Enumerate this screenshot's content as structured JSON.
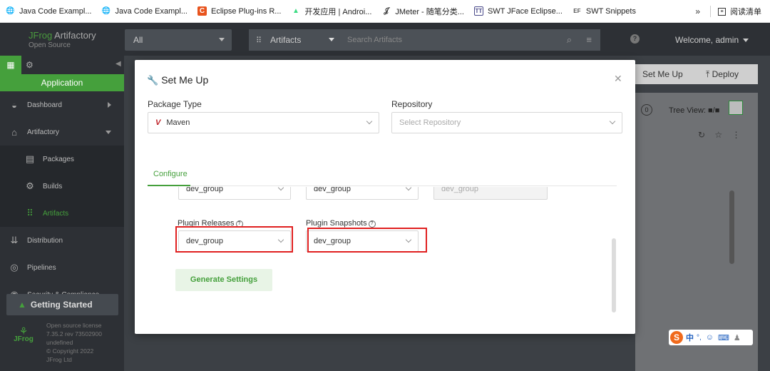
{
  "bookmarks": {
    "items": [
      {
        "label": "Java Code Exampl...",
        "icon": "globe-icon",
        "color": "#333333"
      },
      {
        "label": "Java Code Exampl...",
        "icon": "globe-icon",
        "color": "#333333"
      },
      {
        "label": "Eclipse Plug-ins R...",
        "icon": "c-logo-icon",
        "color": "#e8541e"
      },
      {
        "label": "开发应用 | Androi...",
        "icon": "android-icon",
        "color": "#3ddc84"
      },
      {
        "label": "JMeter - 随笔分类...",
        "icon": "jmeter-icon",
        "color": "#333333"
      },
      {
        "label": "SWT JFace Eclipse...",
        "icon": "tt-icon",
        "color": "#4a4a8a"
      },
      {
        "label": "SWT Snippets",
        "icon": "ef-icon",
        "color": "#555555"
      }
    ],
    "more": "»",
    "reading_list": "阅读清单"
  },
  "topnav": {
    "brand_jfrog": "JFrog",
    "brand_product": " Artifactory",
    "brand_edition": "Open Source",
    "scope_select": "All",
    "package_select": "Artifacts",
    "search_placeholder": "Search Artifacts",
    "welcome": "Welcome, admin"
  },
  "sidebar": {
    "app_label": "Application",
    "items": [
      {
        "label": "Dashboard",
        "icon": "gauge-icon"
      },
      {
        "label": "Artifactory",
        "icon": "artifactory-icon"
      },
      {
        "label": "Packages",
        "icon": "packages-icon"
      },
      {
        "label": "Builds",
        "icon": "builds-icon"
      },
      {
        "label": "Artifacts",
        "icon": "artifacts-tree-icon"
      },
      {
        "label": "Distribution",
        "icon": "distribution-icon"
      },
      {
        "label": "Pipelines",
        "icon": "pipelines-icon"
      },
      {
        "label": "Security & Compliance",
        "icon": "security-icon"
      }
    ],
    "getting_started": "Getting Started",
    "license": [
      "Open source license",
      "7.35.2 rev 73502900",
      "undefined",
      "© Copyright 2022",
      "JFrog Ltd"
    ],
    "logo_text": "JFrog"
  },
  "background": {
    "set_me_up": "Set Me Up",
    "deploy": "Deploy",
    "zero_badge": "0",
    "tree_view": "Tree View:"
  },
  "modal": {
    "title": "Set Me Up",
    "package_type_label": "Package Type",
    "package_type_value": "Maven",
    "repository_label": "Repository",
    "repository_placeholder": "Select Repository",
    "tab_configure": "Configure",
    "row1_values": [
      "dev_group",
      "dev_group",
      "dev_group"
    ],
    "plugin_releases_label": "Plugin Releases",
    "plugin_releases_value": "dev_group",
    "plugin_snapshots_label": "Plugin Snapshots",
    "plugin_snapshots_value": "dev_group",
    "generate_button": "Generate Settings"
  },
  "ime": {
    "logo": "S",
    "mode": "中",
    "punct": "°,"
  },
  "colors": {
    "jfrog_green": "#45a03c",
    "highlight_red": "#e02020",
    "maven_red": "#c0272d"
  }
}
